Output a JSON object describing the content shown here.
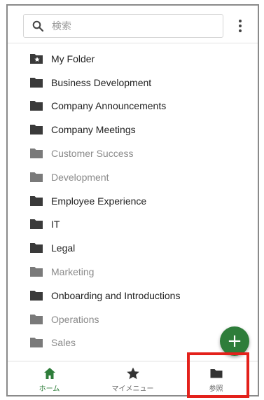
{
  "search": {
    "placeholder": "検索"
  },
  "folders": [
    {
      "label": "My Folder",
      "icon": "starred-folder-icon",
      "muted": false
    },
    {
      "label": "Business Development",
      "icon": "folder-icon",
      "muted": false
    },
    {
      "label": "Company Announcements",
      "icon": "folder-icon",
      "muted": false
    },
    {
      "label": "Company Meetings",
      "icon": "folder-icon",
      "muted": false
    },
    {
      "label": "Customer Success",
      "icon": "folder-icon",
      "muted": true
    },
    {
      "label": "Development",
      "icon": "folder-icon",
      "muted": true
    },
    {
      "label": "Employee Experience",
      "icon": "folder-icon",
      "muted": false
    },
    {
      "label": "IT",
      "icon": "folder-icon",
      "muted": false
    },
    {
      "label": "Legal",
      "icon": "folder-icon",
      "muted": false
    },
    {
      "label": "Marketing",
      "icon": "folder-icon",
      "muted": true
    },
    {
      "label": "Onboarding and Introductions",
      "icon": "folder-icon",
      "muted": false
    },
    {
      "label": "Operations",
      "icon": "folder-icon",
      "muted": true
    },
    {
      "label": "Sales",
      "icon": "folder-icon",
      "muted": true
    }
  ],
  "fab": {
    "label": "+",
    "icon": "plus-icon"
  },
  "bottom_nav": [
    {
      "label": "ホーム",
      "icon": "home-icon",
      "active": true
    },
    {
      "label": "マイメニュー",
      "icon": "star-icon",
      "active": false
    },
    {
      "label": "参照",
      "icon": "folder-icon",
      "active": false
    }
  ],
  "colors": {
    "accent": "#2e7d3a",
    "highlight": "#e3211b",
    "folder_dark": "#3a3a3a",
    "folder_muted": "#7a7a7a"
  }
}
